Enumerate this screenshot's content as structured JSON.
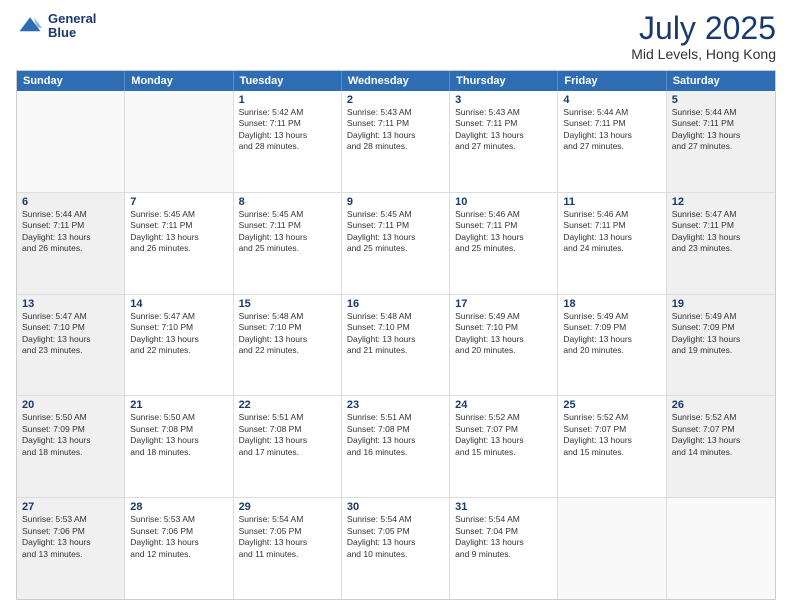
{
  "header": {
    "logo_line1": "General",
    "logo_line2": "Blue",
    "month_title": "July 2025",
    "location": "Mid Levels, Hong Kong"
  },
  "weekdays": [
    "Sunday",
    "Monday",
    "Tuesday",
    "Wednesday",
    "Thursday",
    "Friday",
    "Saturday"
  ],
  "rows": [
    [
      {
        "day": "",
        "empty": true
      },
      {
        "day": "",
        "empty": true
      },
      {
        "day": "1",
        "lines": [
          "Sunrise: 5:42 AM",
          "Sunset: 7:11 PM",
          "Daylight: 13 hours",
          "and 28 minutes."
        ]
      },
      {
        "day": "2",
        "lines": [
          "Sunrise: 5:43 AM",
          "Sunset: 7:11 PM",
          "Daylight: 13 hours",
          "and 28 minutes."
        ]
      },
      {
        "day": "3",
        "lines": [
          "Sunrise: 5:43 AM",
          "Sunset: 7:11 PM",
          "Daylight: 13 hours",
          "and 27 minutes."
        ]
      },
      {
        "day": "4",
        "lines": [
          "Sunrise: 5:44 AM",
          "Sunset: 7:11 PM",
          "Daylight: 13 hours",
          "and 27 minutes."
        ]
      },
      {
        "day": "5",
        "lines": [
          "Sunrise: 5:44 AM",
          "Sunset: 7:11 PM",
          "Daylight: 13 hours",
          "and 27 minutes."
        ]
      }
    ],
    [
      {
        "day": "6",
        "lines": [
          "Sunrise: 5:44 AM",
          "Sunset: 7:11 PM",
          "Daylight: 13 hours",
          "and 26 minutes."
        ]
      },
      {
        "day": "7",
        "lines": [
          "Sunrise: 5:45 AM",
          "Sunset: 7:11 PM",
          "Daylight: 13 hours",
          "and 26 minutes."
        ]
      },
      {
        "day": "8",
        "lines": [
          "Sunrise: 5:45 AM",
          "Sunset: 7:11 PM",
          "Daylight: 13 hours",
          "and 25 minutes."
        ]
      },
      {
        "day": "9",
        "lines": [
          "Sunrise: 5:45 AM",
          "Sunset: 7:11 PM",
          "Daylight: 13 hours",
          "and 25 minutes."
        ]
      },
      {
        "day": "10",
        "lines": [
          "Sunrise: 5:46 AM",
          "Sunset: 7:11 PM",
          "Daylight: 13 hours",
          "and 25 minutes."
        ]
      },
      {
        "day": "11",
        "lines": [
          "Sunrise: 5:46 AM",
          "Sunset: 7:11 PM",
          "Daylight: 13 hours",
          "and 24 minutes."
        ]
      },
      {
        "day": "12",
        "lines": [
          "Sunrise: 5:47 AM",
          "Sunset: 7:11 PM",
          "Daylight: 13 hours",
          "and 23 minutes."
        ]
      }
    ],
    [
      {
        "day": "13",
        "lines": [
          "Sunrise: 5:47 AM",
          "Sunset: 7:10 PM",
          "Daylight: 13 hours",
          "and 23 minutes."
        ]
      },
      {
        "day": "14",
        "lines": [
          "Sunrise: 5:47 AM",
          "Sunset: 7:10 PM",
          "Daylight: 13 hours",
          "and 22 minutes."
        ]
      },
      {
        "day": "15",
        "lines": [
          "Sunrise: 5:48 AM",
          "Sunset: 7:10 PM",
          "Daylight: 13 hours",
          "and 22 minutes."
        ]
      },
      {
        "day": "16",
        "lines": [
          "Sunrise: 5:48 AM",
          "Sunset: 7:10 PM",
          "Daylight: 13 hours",
          "and 21 minutes."
        ]
      },
      {
        "day": "17",
        "lines": [
          "Sunrise: 5:49 AM",
          "Sunset: 7:10 PM",
          "Daylight: 13 hours",
          "and 20 minutes."
        ]
      },
      {
        "day": "18",
        "lines": [
          "Sunrise: 5:49 AM",
          "Sunset: 7:09 PM",
          "Daylight: 13 hours",
          "and 20 minutes."
        ]
      },
      {
        "day": "19",
        "lines": [
          "Sunrise: 5:49 AM",
          "Sunset: 7:09 PM",
          "Daylight: 13 hours",
          "and 19 minutes."
        ]
      }
    ],
    [
      {
        "day": "20",
        "lines": [
          "Sunrise: 5:50 AM",
          "Sunset: 7:09 PM",
          "Daylight: 13 hours",
          "and 18 minutes."
        ]
      },
      {
        "day": "21",
        "lines": [
          "Sunrise: 5:50 AM",
          "Sunset: 7:08 PM",
          "Daylight: 13 hours",
          "and 18 minutes."
        ]
      },
      {
        "day": "22",
        "lines": [
          "Sunrise: 5:51 AM",
          "Sunset: 7:08 PM",
          "Daylight: 13 hours",
          "and 17 minutes."
        ]
      },
      {
        "day": "23",
        "lines": [
          "Sunrise: 5:51 AM",
          "Sunset: 7:08 PM",
          "Daylight: 13 hours",
          "and 16 minutes."
        ]
      },
      {
        "day": "24",
        "lines": [
          "Sunrise: 5:52 AM",
          "Sunset: 7:07 PM",
          "Daylight: 13 hours",
          "and 15 minutes."
        ]
      },
      {
        "day": "25",
        "lines": [
          "Sunrise: 5:52 AM",
          "Sunset: 7:07 PM",
          "Daylight: 13 hours",
          "and 15 minutes."
        ]
      },
      {
        "day": "26",
        "lines": [
          "Sunrise: 5:52 AM",
          "Sunset: 7:07 PM",
          "Daylight: 13 hours",
          "and 14 minutes."
        ]
      }
    ],
    [
      {
        "day": "27",
        "lines": [
          "Sunrise: 5:53 AM",
          "Sunset: 7:06 PM",
          "Daylight: 13 hours",
          "and 13 minutes."
        ]
      },
      {
        "day": "28",
        "lines": [
          "Sunrise: 5:53 AM",
          "Sunset: 7:06 PM",
          "Daylight: 13 hours",
          "and 12 minutes."
        ]
      },
      {
        "day": "29",
        "lines": [
          "Sunrise: 5:54 AM",
          "Sunset: 7:05 PM",
          "Daylight: 13 hours",
          "and 11 minutes."
        ]
      },
      {
        "day": "30",
        "lines": [
          "Sunrise: 5:54 AM",
          "Sunset: 7:05 PM",
          "Daylight: 13 hours",
          "and 10 minutes."
        ]
      },
      {
        "day": "31",
        "lines": [
          "Sunrise: 5:54 AM",
          "Sunset: 7:04 PM",
          "Daylight: 13 hours",
          "and 9 minutes."
        ]
      },
      {
        "day": "",
        "empty": true
      },
      {
        "day": "",
        "empty": true
      }
    ]
  ]
}
